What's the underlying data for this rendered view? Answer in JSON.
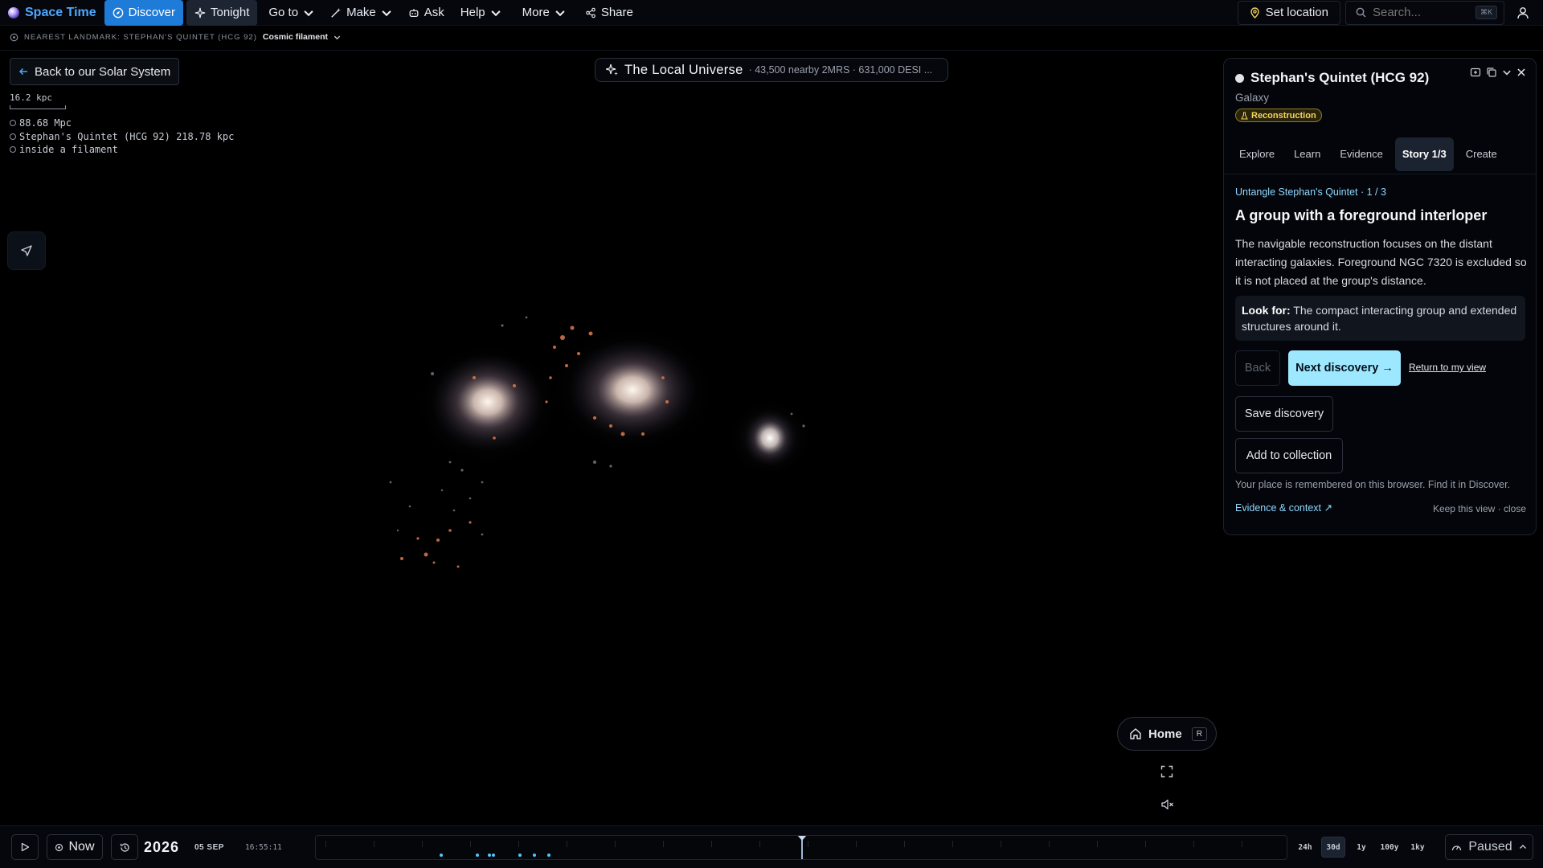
{
  "app": {
    "name": "Space Time"
  },
  "nav": {
    "discover": "Discover",
    "tonight": "Tonight",
    "goto": "Go to",
    "make": "Make",
    "ask": "Ask",
    "help": "Help",
    "more": "More",
    "share": "Share"
  },
  "topright": {
    "set_location": "Set location",
    "search_placeholder": "Search...",
    "search_shortcut": "⌘K"
  },
  "landmark": {
    "label": "NEAREST LANDMARK: STEPHAN'S QUINTET (HCG 92)",
    "context": "Cosmic filament"
  },
  "back_button": "Back to our Solar System",
  "scale": {
    "label": "16.2 kpc",
    "readout": [
      "88.68 Mpc",
      "Stephan's Quintet (HCG 92) 218.78 kpc",
      "inside a filament"
    ]
  },
  "title_pill": {
    "title": "The Local Universe",
    "subtitle": "· 43,500 nearby 2MRS · 631,000 DESI ..."
  },
  "panel": {
    "title": "Stephan's Quintet (HCG 92)",
    "subtitle": "Galaxy",
    "badge": "Reconstruction",
    "tabs": [
      "Explore",
      "Learn",
      "Evidence",
      "Story 1/3",
      "Create"
    ],
    "story_label": "Untangle Stephan's Quintet · 1 / 3",
    "heading": "A group with a foreground interloper",
    "body": "The navigable reconstruction focuses on the distant interacting galaxies. Foreground NGC 7320 is excluded so it is not placed at the group's distance.",
    "look_for_label": "Look for:",
    "look_for_text": " The compact interacting group and extended structures around it.",
    "back": "Back",
    "next": "Next discovery →",
    "return": "Return to my view",
    "save": "Save discovery",
    "collection": "Add to collection",
    "note": "Your place is remembered on this browser. Find it in Discover.",
    "evidence_link": "Evidence & context ↗",
    "keep": "Keep this view · close"
  },
  "home": {
    "label": "Home",
    "key": "R"
  },
  "bottom": {
    "now": "Now",
    "year": "2026",
    "date": "05 SEP",
    "time": "16:55:11",
    "ranges": [
      "24h",
      "30d",
      "1y",
      "100y",
      "1ky"
    ],
    "active_range": "30d",
    "status": "Paused"
  },
  "colors": {
    "accent": "#1f7bd8",
    "brand": "#4ea8ff",
    "cta": "#9ee8ff",
    "badge": "#f5d55f"
  }
}
